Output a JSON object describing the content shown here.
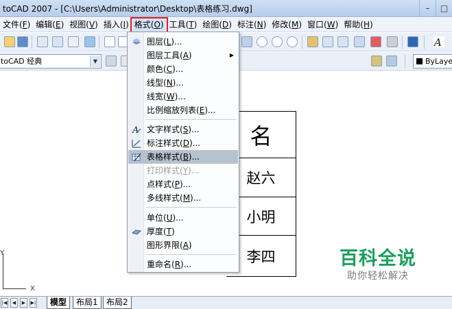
{
  "window": {
    "title": "toCAD 2007 - [C:\\Users\\Administrator\\Desktop\\表格练习.dwg]"
  },
  "menubar": {
    "items": [
      {
        "label": "文件(",
        "hotkey": "F",
        "suffix": ")"
      },
      {
        "label": "编辑(",
        "hotkey": "E",
        "suffix": ")"
      },
      {
        "label": "视图(",
        "hotkey": "V",
        "suffix": ")"
      },
      {
        "label": "插入(",
        "hotkey": "I",
        "suffix": ")"
      },
      {
        "label": "格式(",
        "hotkey": "O",
        "suffix": ")"
      },
      {
        "label": "工具(",
        "hotkey": "T",
        "suffix": ")"
      },
      {
        "label": "绘图(",
        "hotkey": "D",
        "suffix": ")"
      },
      {
        "label": "标注(",
        "hotkey": "N",
        "suffix": ")"
      },
      {
        "label": "修改(",
        "hotkey": "M",
        "suffix": ")"
      },
      {
        "label": "窗口(",
        "hotkey": "W",
        "suffix": ")"
      },
      {
        "label": "帮助(",
        "hotkey": "H",
        "suffix": ")"
      }
    ],
    "highlight_color": "#e02020"
  },
  "toolbar2": {
    "workspace": "toCAD 经典",
    "layer": "ByLaye"
  },
  "format_menu": {
    "items": [
      {
        "label": "图层(",
        "hotkey": "L",
        "suffix": ")...",
        "icon": "layers-icon"
      },
      {
        "label": "图层工具(",
        "hotkey": "A",
        "suffix": ")",
        "submenu": true
      },
      {
        "label": "颜色(",
        "hotkey": "C",
        "suffix": ")..."
      },
      {
        "label": "线型(",
        "hotkey": "N",
        "suffix": ")..."
      },
      {
        "label": "线宽(",
        "hotkey": "W",
        "suffix": ")..."
      },
      {
        "label": "比例缩放列表(",
        "hotkey": "E",
        "suffix": ")..."
      },
      {
        "label": "文字样式(",
        "hotkey": "S",
        "suffix": ")...",
        "icon": "text-style-icon"
      },
      {
        "label": "标注样式(",
        "hotkey": "D",
        "suffix": ")...",
        "icon": "dim-style-icon"
      },
      {
        "label": "表格样式(",
        "hotkey": "B",
        "suffix": ")...",
        "icon": "table-style-icon",
        "highlight": true
      },
      {
        "label": "打印样式(",
        "hotkey": "Y",
        "suffix": ")...",
        "disabled": true
      },
      {
        "label": "点样式(",
        "hotkey": "P",
        "suffix": ")..."
      },
      {
        "label": "多线样式(",
        "hotkey": "M",
        "suffix": ")..."
      },
      {
        "label": "单位(",
        "hotkey": "U",
        "suffix": ")..."
      },
      {
        "label": "厚度(",
        "hotkey": "T",
        "suffix": ")",
        "icon": "thickness-icon"
      },
      {
        "label": "图形界限(",
        "hotkey": "A",
        "suffix": ")"
      },
      {
        "label": "重命名(",
        "hotkey": "R",
        "suffix": ")..."
      }
    ]
  },
  "drawing": {
    "table_header": "名",
    "table_rows": [
      "赵六",
      "小明",
      "李四"
    ],
    "ucs_x": "X",
    "ucs_y": "Y"
  },
  "watermark": {
    "main": "百科全说",
    "sub": "助你轻松解决",
    "color": "#1aa05a"
  },
  "tabs": {
    "items": [
      "模型",
      "布局1",
      "布局2"
    ]
  },
  "nav_buttons": [
    "|◀",
    "◀",
    "▶",
    "▶|"
  ]
}
